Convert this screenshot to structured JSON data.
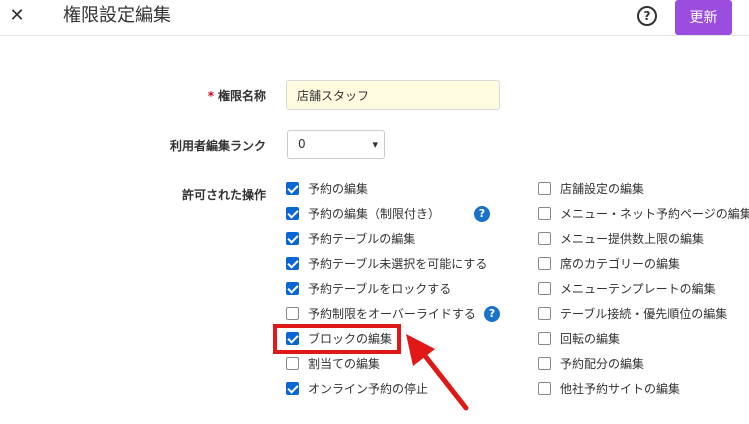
{
  "header": {
    "close_icon": "✕",
    "title": "権限設定編集",
    "help_icon": "?",
    "update_label": "更新"
  },
  "form": {
    "name": {
      "required_mark": "*",
      "label": "権限名称",
      "value": "店舗スタッフ"
    },
    "rank": {
      "label": "利用者編集ランク",
      "value": "0",
      "chevron": "▾"
    },
    "permissions": {
      "label": "許可された操作",
      "help_icon": "?",
      "left": [
        {
          "label": "予約の編集",
          "checked": true
        },
        {
          "label": "予約の編集（制限付き）",
          "checked": true
        },
        {
          "label": "予約テーブルの編集",
          "checked": true
        },
        {
          "label": "予約テーブル未選択を可能にする",
          "checked": true
        },
        {
          "label": "予約テーブルをロックする",
          "checked": true
        },
        {
          "label": "予約制限をオーバーライドする",
          "checked": false
        },
        {
          "label": "ブロックの編集",
          "checked": true
        },
        {
          "label": "割当ての編集",
          "checked": false
        },
        {
          "label": "オンライン予約の停止",
          "checked": true
        }
      ],
      "right": [
        {
          "label": "店舗設定の編集",
          "checked": false
        },
        {
          "label": "メニュー・ネット予約ページの編集",
          "checked": false
        },
        {
          "label": "メニュー提供数上限の編集",
          "checked": false
        },
        {
          "label": "席のカテゴリーの編集",
          "checked": false
        },
        {
          "label": "メニューテンプレートの編集",
          "checked": false
        },
        {
          "label": "テーブル接続・優先順位の編集",
          "checked": false
        },
        {
          "label": "回転の編集",
          "checked": false
        },
        {
          "label": "予約配分の編集",
          "checked": false
        },
        {
          "label": "他社予約サイトの編集",
          "checked": false
        }
      ]
    }
  },
  "colors": {
    "accent": "#9b4de0",
    "checkbox": "#0a66d2",
    "highlight": "#e01818",
    "input_bg": "#fffbe0"
  }
}
